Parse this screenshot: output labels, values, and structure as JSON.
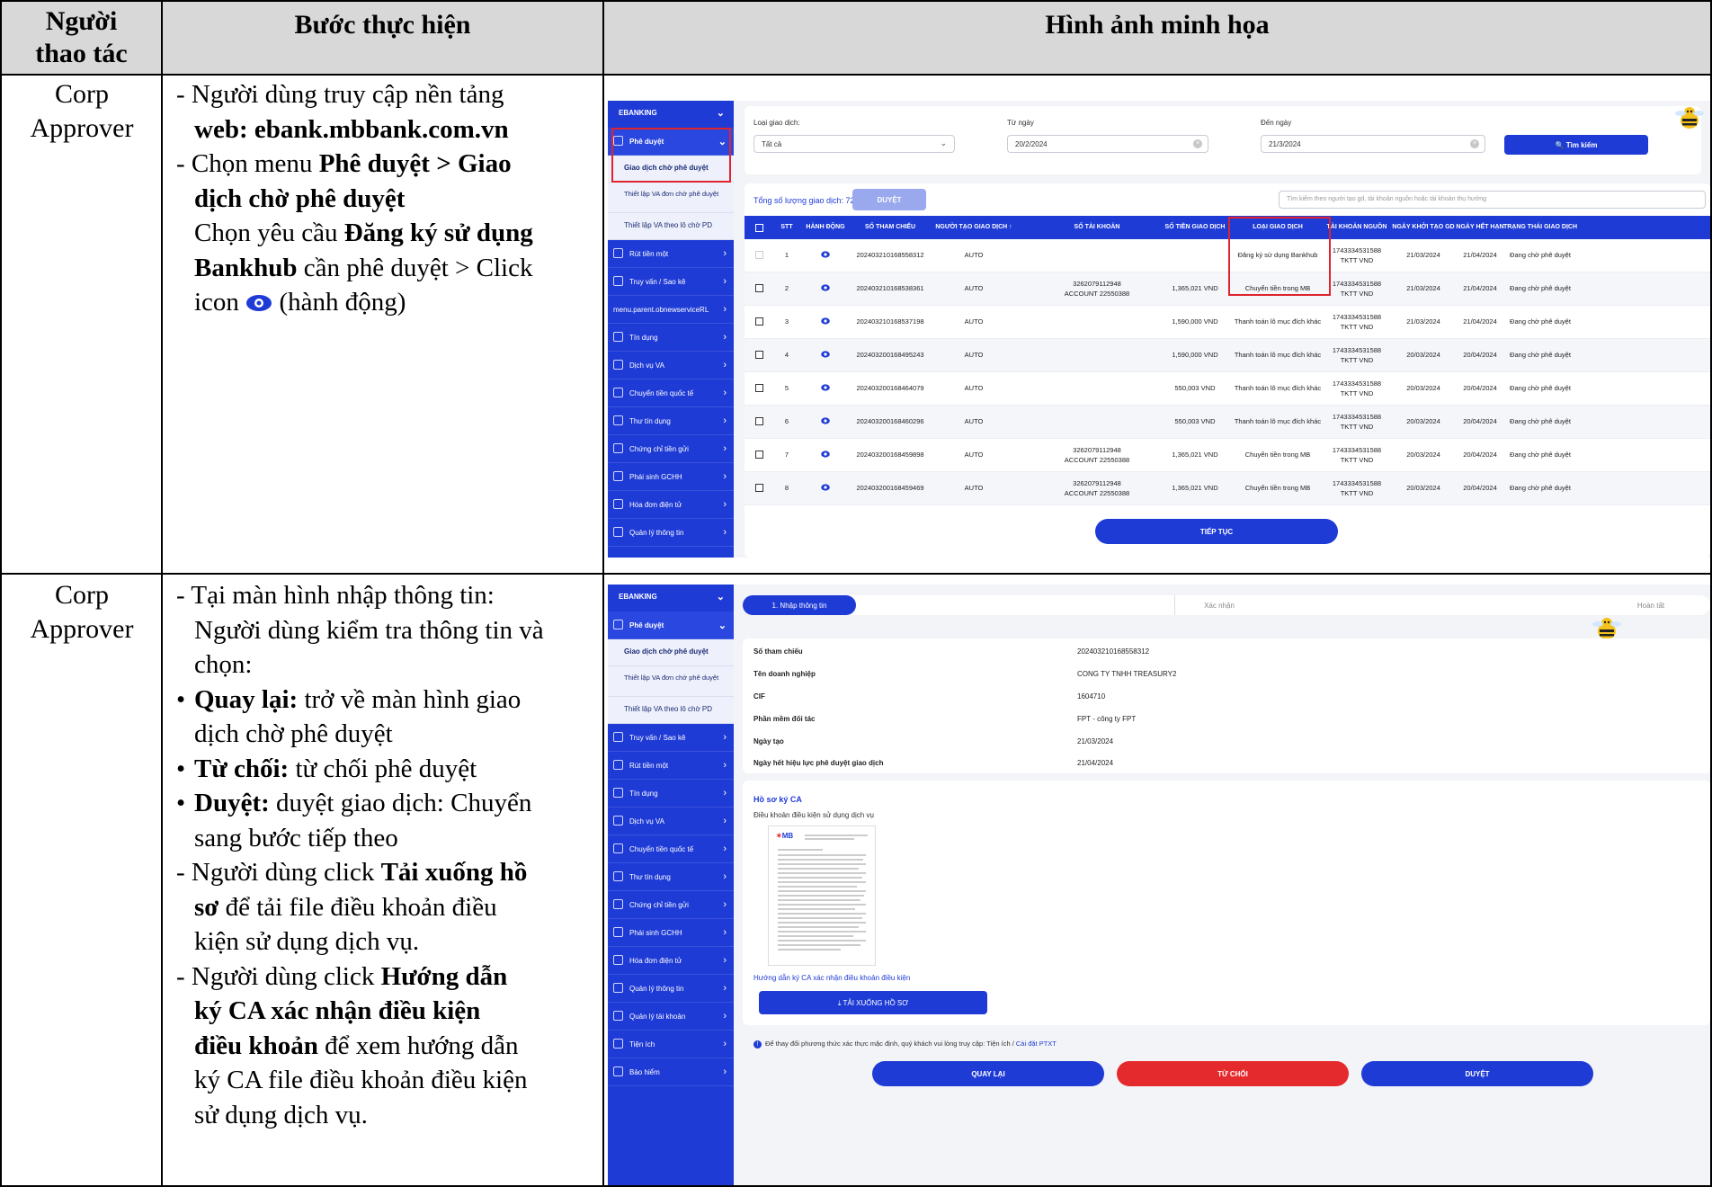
{
  "table": {
    "headers": [
      "Người thao tác",
      "Bước thực hiện",
      "Hình ảnh minh họa"
    ],
    "header_lines": {
      "actor": [
        "Người",
        "thao tác"
      ]
    },
    "row1": {
      "actor": [
        "Corp",
        "Approver"
      ],
      "steps": {
        "l1a": "- Người dùng truy cập nền tảng",
        "l1b": "web: ebank.mbbank.com.vn",
        "l2a": "- Chọn menu ",
        "l2b": "Phê duyệt > Giao",
        "l2c": "dịch chờ phê duyệt",
        "l3a": "Chọn yêu cầu ",
        "l3b": "Đăng ký sử dụng",
        "l4a": "Bankhub",
        "l4b": " cần phê duyệt > Click",
        "l5a": "icon ",
        "l5b": " (hành động)"
      }
    },
    "row2": {
      "actor": [
        "Corp",
        "Approver"
      ],
      "steps": {
        "a1": "- Tại màn hình nhập thông tin:",
        "a2": "Người dùng kiểm tra thông tin và",
        "a3": "chọn:",
        "b1b": "Quay lại:",
        "b1": " trở về màn hình giao",
        "b2": "dịch chờ phê duyệt",
        "c1b": "Từ chối:",
        "c1": " từ chối phê duyệt",
        "d1b": "Duyệt:",
        "d1": " duyệt giao dịch: Chuyển",
        "d2": "sang bước tiếp theo",
        "e1a": "- Người dùng click ",
        "e1b": "Tải xuống hồ",
        "e2b": "sơ",
        "e2": " để tải file điều khoản điều",
        "e3": "kiện sử dụng dịch vụ.",
        "f1a": "- Người dùng click ",
        "f1b": "Hướng dẫn",
        "f2b": "ký CA xác nhận điều kiện",
        "f3b": "điều khoản",
        "f3": " để xem hướng dẫn",
        "f4": "ký CA file điều khoản điều kiện",
        "f5": "sử dụng dịch vụ."
      }
    }
  },
  "shot1": {
    "sidebar": {
      "title": "EBANKING",
      "active": "Phê duyệt",
      "sub_selected": "Giao dịch chờ phê duyệt",
      "sub2": "Thiết lập VA đơn chờ phê duyệt",
      "sub3": "Thiết lập VA theo lô chờ PD",
      "items": [
        "Rút tiền một",
        "Truy vấn / Sao kê",
        "menu.parent.obnewserviceRL",
        "Tín dụng",
        "Dịch vụ VA",
        "Chuyển tiền quốc tế",
        "Thư tín dụng",
        "Chứng chỉ tiền gửi",
        "Phái sinh GCHH",
        "Hóa đơn điện tử",
        "Quản lý thông tin"
      ]
    },
    "filter": {
      "type_label": "Loại giao dịch:",
      "type_value": "Tất cả",
      "from_label": "Từ ngày",
      "from_value": "20/2/2024",
      "to_label": "Đến ngày",
      "to_value": "21/3/2024",
      "search_btn": "Tìm kiếm"
    },
    "summary": {
      "total": "Tổng số lượng giao dịch: 72",
      "approve_btn": "DUYỆT",
      "search_placeholder": "Tìm kiếm theo người tạo gd, tài khoản nguồn hoặc tài khoản thụ hưởng"
    },
    "columns": [
      "STT",
      "HÀNH ĐỘNG",
      "SỐ THAM CHIẾU",
      "NGƯỜI TẠO GIAO DỊCH ↑",
      "SỐ TÀI KHOẢN",
      "SỐ TIỀN GIAO DỊCH",
      "LOẠI GIAO DỊCH",
      "TÀI KHOẢN NGUỒN",
      "NGÀY KHỞI TẠO GD",
      "NGÀY HẾT HẠN",
      "TRẠNG THÁI GIAO DỊCH"
    ],
    "rows": [
      {
        "stt": "1",
        "ref": "20240321016855831​2",
        "creator": "AUTO",
        "acc1": "",
        "acc2": "",
        "amount": "",
        "type": "Đăng ký sử dụng Bankhub",
        "src1": "17433345315​88",
        "src2": "TKTT VND",
        "created": "21/03/2024",
        "expire": "21/04/2024",
        "status": "Đang chờ phê duyệt"
      },
      {
        "stt": "2",
        "ref": "202403210168538361",
        "creator": "AUTO",
        "acc1": "3262079112948",
        "acc2": "ACCOUNT 22550388",
        "amount": "1,365,021 VND",
        "type": "Chuyển tiền trong MB",
        "src1": "174333453158​8",
        "src2": "TKTT VND",
        "created": "21/03/2024",
        "expire": "21/04/2024",
        "status": "Đang chờ phê duyệt"
      },
      {
        "stt": "3",
        "ref": "202403210168537198",
        "creator": "AUTO",
        "acc1": "",
        "acc2": "",
        "amount": "1,590,000 VND",
        "type": "Thanh toán lô mục đích khác",
        "src1": "1743334531588",
        "src2": "TKTT VND",
        "created": "21/03/2024",
        "expire": "21/04/2024",
        "status": "Đang chờ phê duyệt"
      },
      {
        "stt": "4",
        "ref": "202403200168495243",
        "creator": "AUTO",
        "acc1": "",
        "acc2": "",
        "amount": "1,590,000 VND",
        "type": "Thanh toán lô mục đích khác",
        "src1": "1743334531588",
        "src2": "TKTT VND",
        "created": "20/03/2024",
        "expire": "20/04/2024",
        "status": "Đang chờ phê duyệt"
      },
      {
        "stt": "5",
        "ref": "202403200168464079",
        "creator": "AUTO",
        "acc1": "",
        "acc2": "",
        "amount": "550,003 VND",
        "type": "Thanh toán lô mục đích khác",
        "src1": "1743334531588",
        "src2": "TKTT VND",
        "created": "20/03/2024",
        "expire": "20/04/2024",
        "status": "Đang chờ phê duyệt"
      },
      {
        "stt": "6",
        "ref": "202403200168460296",
        "creator": "AUTO",
        "acc1": "",
        "acc2": "",
        "amount": "550,003 VND",
        "type": "Thanh toán lô mục đích khác",
        "src1": "1743334531588",
        "src2": "TKTT VND",
        "created": "20/03/2024",
        "expire": "20/04/2024",
        "status": "Đang chờ phê duyệt"
      },
      {
        "stt": "7",
        "ref": "202403200168459898",
        "creator": "AUTO",
        "acc1": "3262079112948",
        "acc2": "ACCOUNT 22550388",
        "amount": "1,365,021 VND",
        "type": "Chuyển tiền trong MB",
        "src1": "1743334531588",
        "src2": "TKTT VND",
        "created": "20/03/2024",
        "expire": "20/04/2024",
        "status": "Đang chờ phê duyệt"
      },
      {
        "stt": "8",
        "ref": "202403200168459469",
        "creator": "AUTO",
        "acc1": "3262079112948",
        "acc2": "ACCOUNT 22550388",
        "amount": "1,365,021 VND",
        "type": "Chuyển tiền trong MB",
        "src1": "1743334531588",
        "src2": "TKTT VND",
        "created": "20/03/2024",
        "expire": "20/04/2024",
        "status": "Đang chờ phê duyệt"
      }
    ],
    "continue_btn": "TIẾP TỤC"
  },
  "shot2": {
    "sidebar": {
      "title": "EBANKING",
      "active": "Phê duyệt",
      "sub_selected": "Giao dịch chờ phê duyệt",
      "sub2": "Thiết lập VA đơn chờ phê duyệt",
      "sub3": "Thiết lập VA theo lô chờ PD",
      "items": [
        "Truy vấn / Sao kê",
        "Rút tiền một",
        "Tín dụng",
        "Dịch vụ VA",
        "Chuyển tiền quốc tế",
        "Thư tín dụng",
        "Chứng chỉ tiền gửi",
        "Phái sinh GCHH",
        "Hóa đơn điện tử",
        "Quản lý thông tin",
        "Quản lý tài khoản",
        "Tiện ích",
        "Bảo hiểm"
      ]
    },
    "stepper": [
      "1. Nhập thông tin",
      "Xác nhận",
      "Hoàn tất"
    ],
    "details": [
      {
        "k": "Số tham chiếu",
        "v": "202403210168558312"
      },
      {
        "k": "Tên doanh nghiệp",
        "v": "CONG TY TNHH TREASURY2"
      },
      {
        "k": "CIF",
        "v": "1604710"
      },
      {
        "k": "Phần mềm đối tác",
        "v": "FPT - công ty FPT"
      },
      {
        "k": "Ngày tạo",
        "v": "21/03/2024"
      },
      {
        "k": "Ngày hết hiệu lực phê duyệt giao dịch",
        "v": "21/04/2024"
      }
    ],
    "ca": {
      "title": "Hồ sơ ký CA",
      "desc": "Điều khoản điều kiện sử dụng dịch vụ",
      "doc_logo": "MB",
      "guide_link": "Hướng dẫn ký CA xác nhận điều khoản điều kiện",
      "download_btn": "TẢI XUỐNG HỒ SƠ"
    },
    "notice": "Để thay đổi phương thức xác thực mặc định, quý khách vui lòng truy cập: Tiện ích / ",
    "notice_link": "Cài đặt PTXT",
    "buttons": {
      "back": "QUAY LẠI",
      "reject": "TỪ CHỐI",
      "approve": "DUYỆT"
    }
  },
  "colors": {
    "brand_blue": "#1f3bd6",
    "highlight_red": "#e0232d",
    "reject_red": "#e52a2d",
    "header_gray": "#d8d8d8"
  }
}
